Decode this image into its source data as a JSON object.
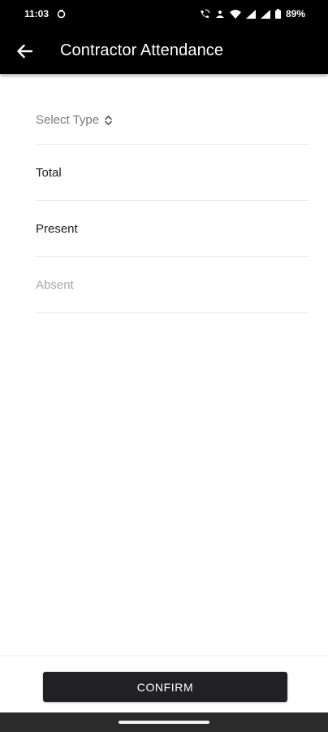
{
  "status_bar": {
    "time": "11:03",
    "battery": "89%",
    "icons": [
      "sync-icon",
      "wifi-calling-icon",
      "data-saver-icon",
      "wifi-icon",
      "signal-icon",
      "signal-icon",
      "battery-icon"
    ]
  },
  "app_bar": {
    "title": "Contractor Attendance",
    "back_icon": "arrow-left-icon"
  },
  "form": {
    "select_type": {
      "label": "Select Type",
      "icon": "chevron-up-down-icon"
    },
    "total": {
      "label": "Total"
    },
    "present": {
      "label": "Present"
    },
    "absent": {
      "placeholder": "Absent"
    }
  },
  "actions": {
    "confirm_label": "CONFIRM"
  },
  "colors": {
    "app_bar": "#000000",
    "button": "#212124",
    "placeholder": "#a8a8a8",
    "divider": "#ececec"
  }
}
